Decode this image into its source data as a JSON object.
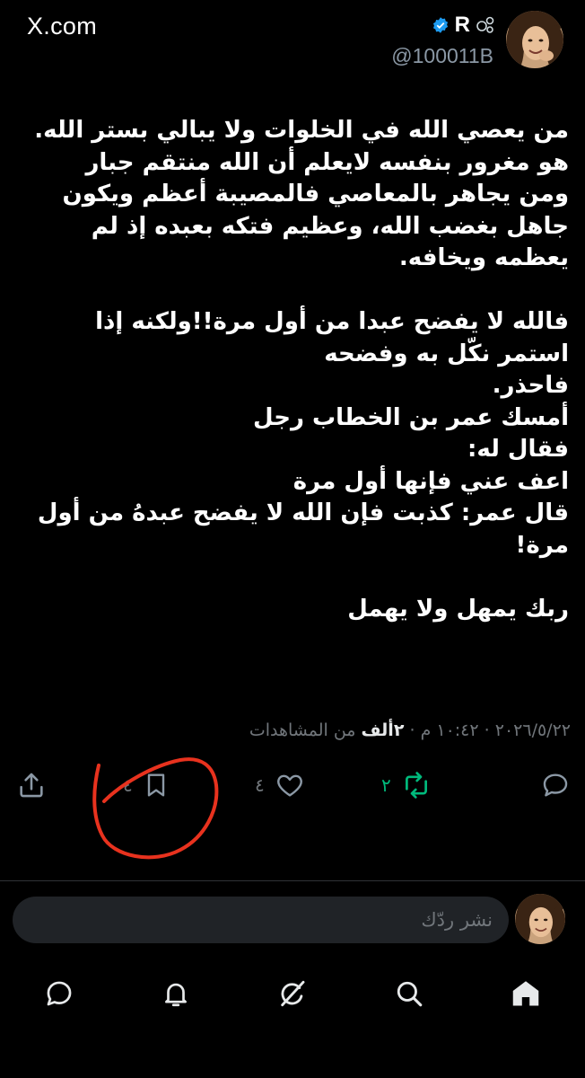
{
  "header": {
    "site": "X.com",
    "display_name": "R",
    "handle": "@100011B",
    "verified": true
  },
  "tweet": {
    "text": "من يعصي الله في الخلوات ولا يبالي بستر الله. هو مغرور بنفسه لايعلم أن الله منتقم جبار\nومن يجاهر بالمعاصي فالمصيبة أعظم ويكون جاهل بغضب الله، وعظيم فتكه بعبده إذ لم يعظمه ويخافه.\n\nفالله لا يفضح عبدا من أول مرة!!ولكنه إذا استمر نكّل به وفضحه\nفاحذر.\nأمسك عمر بن الخطاب رجل\nفقال له:\nاعف عني فإنها أول مرة\nقال عمر: كذبت فإن الله لا يفضح عبدهُ من أول مرة!\n\nربك يمهل ولا يهمل",
    "date": "٢٠٢٦/٥/٢٢",
    "separator": "·",
    "time": "١٠:٤٢ م",
    "views_count": "٢ألف",
    "views_label": "من المشاهدات"
  },
  "actions": {
    "reply_icon": "speech-bubble-icon",
    "retweet_count": "٢",
    "retweet_icon": "retweet-arrows-icon",
    "like_count": "٤",
    "like_icon": "heart-icon",
    "bookmark_count": "٤",
    "bookmark_icon": "bookmark-icon",
    "share_icon": "share-upload-icon"
  },
  "reply": {
    "placeholder": "نشر ردّك"
  },
  "nav": [
    "home-icon",
    "search-icon",
    "grok-icon",
    "notifications-bell-icon",
    "messages-icon"
  ],
  "colors": {
    "background": "#000000",
    "text": "#e7e9ea",
    "muted": "#71767b",
    "retweet_green": "#00ba7c",
    "verified_blue": "#1d9bf0",
    "annotation_red": "#e8321e"
  }
}
